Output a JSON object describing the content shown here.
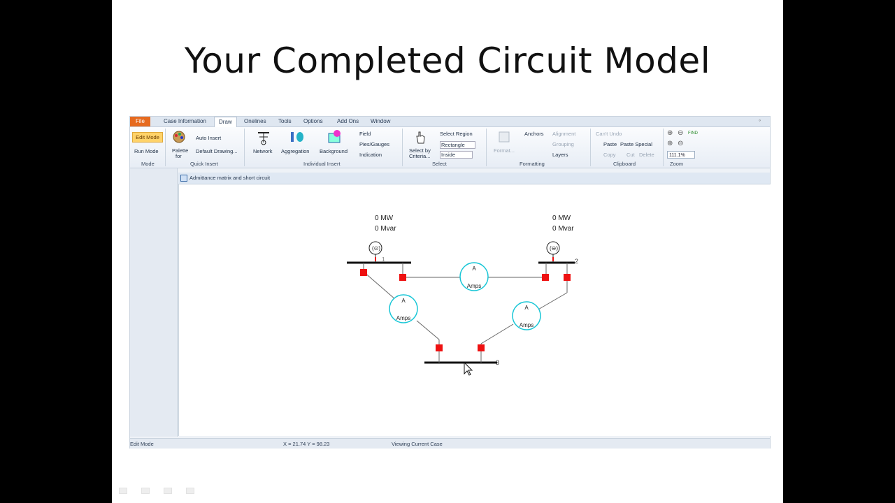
{
  "slide": {
    "title": "Your Completed Circuit Model"
  },
  "menubar": {
    "file": "File",
    "tabs": [
      "Case Information",
      "Draw",
      "Onelines",
      "Tools",
      "Options",
      "Add Ons",
      "Window"
    ]
  },
  "ribbon": {
    "mode": {
      "edit_mode": "Edit Mode",
      "run_mode": "Run Mode",
      "label": "Mode"
    },
    "quick_insert": {
      "palette": "Palette",
      "palette_for": "for",
      "auto_insert": "Auto Insert",
      "default_drawing": "Default Drawing...",
      "label": "Quick Insert"
    },
    "individual_insert": {
      "network": "Network",
      "aggregation": "Aggregation",
      "background": "Background",
      "field": "Field",
      "pies_gauges": "Pies/Gauges",
      "indication": "Indication",
      "label": "Individual Insert"
    },
    "select": {
      "select_by": "Select by",
      "criteria": "Criteria...",
      "select_region": "Select Region",
      "rectangle": "Rectangle",
      "inside": "Inside",
      "label": "Select"
    },
    "formatting": {
      "format": "Format...",
      "anchors": "Anchors",
      "alignment": "Alignment",
      "grouping": "Grouping",
      "layers": "Layers",
      "label": "Formatting"
    },
    "clipboard": {
      "cant_undo": "Can't Undo",
      "paste": "Paste",
      "paste_special": "Paste Special",
      "copy": "Copy",
      "cut": "Cut",
      "delete": "Delete",
      "label": "Clipboard"
    },
    "zoom": {
      "level": "111.1%",
      "find": "FIND",
      "label": "Zoom"
    }
  },
  "document": {
    "tab_title": "Admittance matrix and short circuit"
  },
  "oneline": {
    "gen1": {
      "mw": "0 MW",
      "mvar": "0 Mvar"
    },
    "gen2": {
      "mw": "0 MW",
      "mvar": "0 Mvar"
    },
    "bus1_label": "1",
    "bus2_label": "2",
    "bus3_label": "3",
    "meter_top": {
      "a": "A",
      "amps": "Amps"
    },
    "meter_left": {
      "a": "A",
      "amps": "Amps"
    },
    "meter_right": {
      "a": "A",
      "amps": "Amps"
    }
  },
  "statusbar": {
    "mode": "Edit Mode",
    "coords": "X = 21.74 Y = 98.23",
    "viewing": "Viewing Current Case"
  },
  "colors": {
    "breaker": "#ee1111",
    "meter": "#17c6d6",
    "file_tab": "#e66a1f"
  }
}
